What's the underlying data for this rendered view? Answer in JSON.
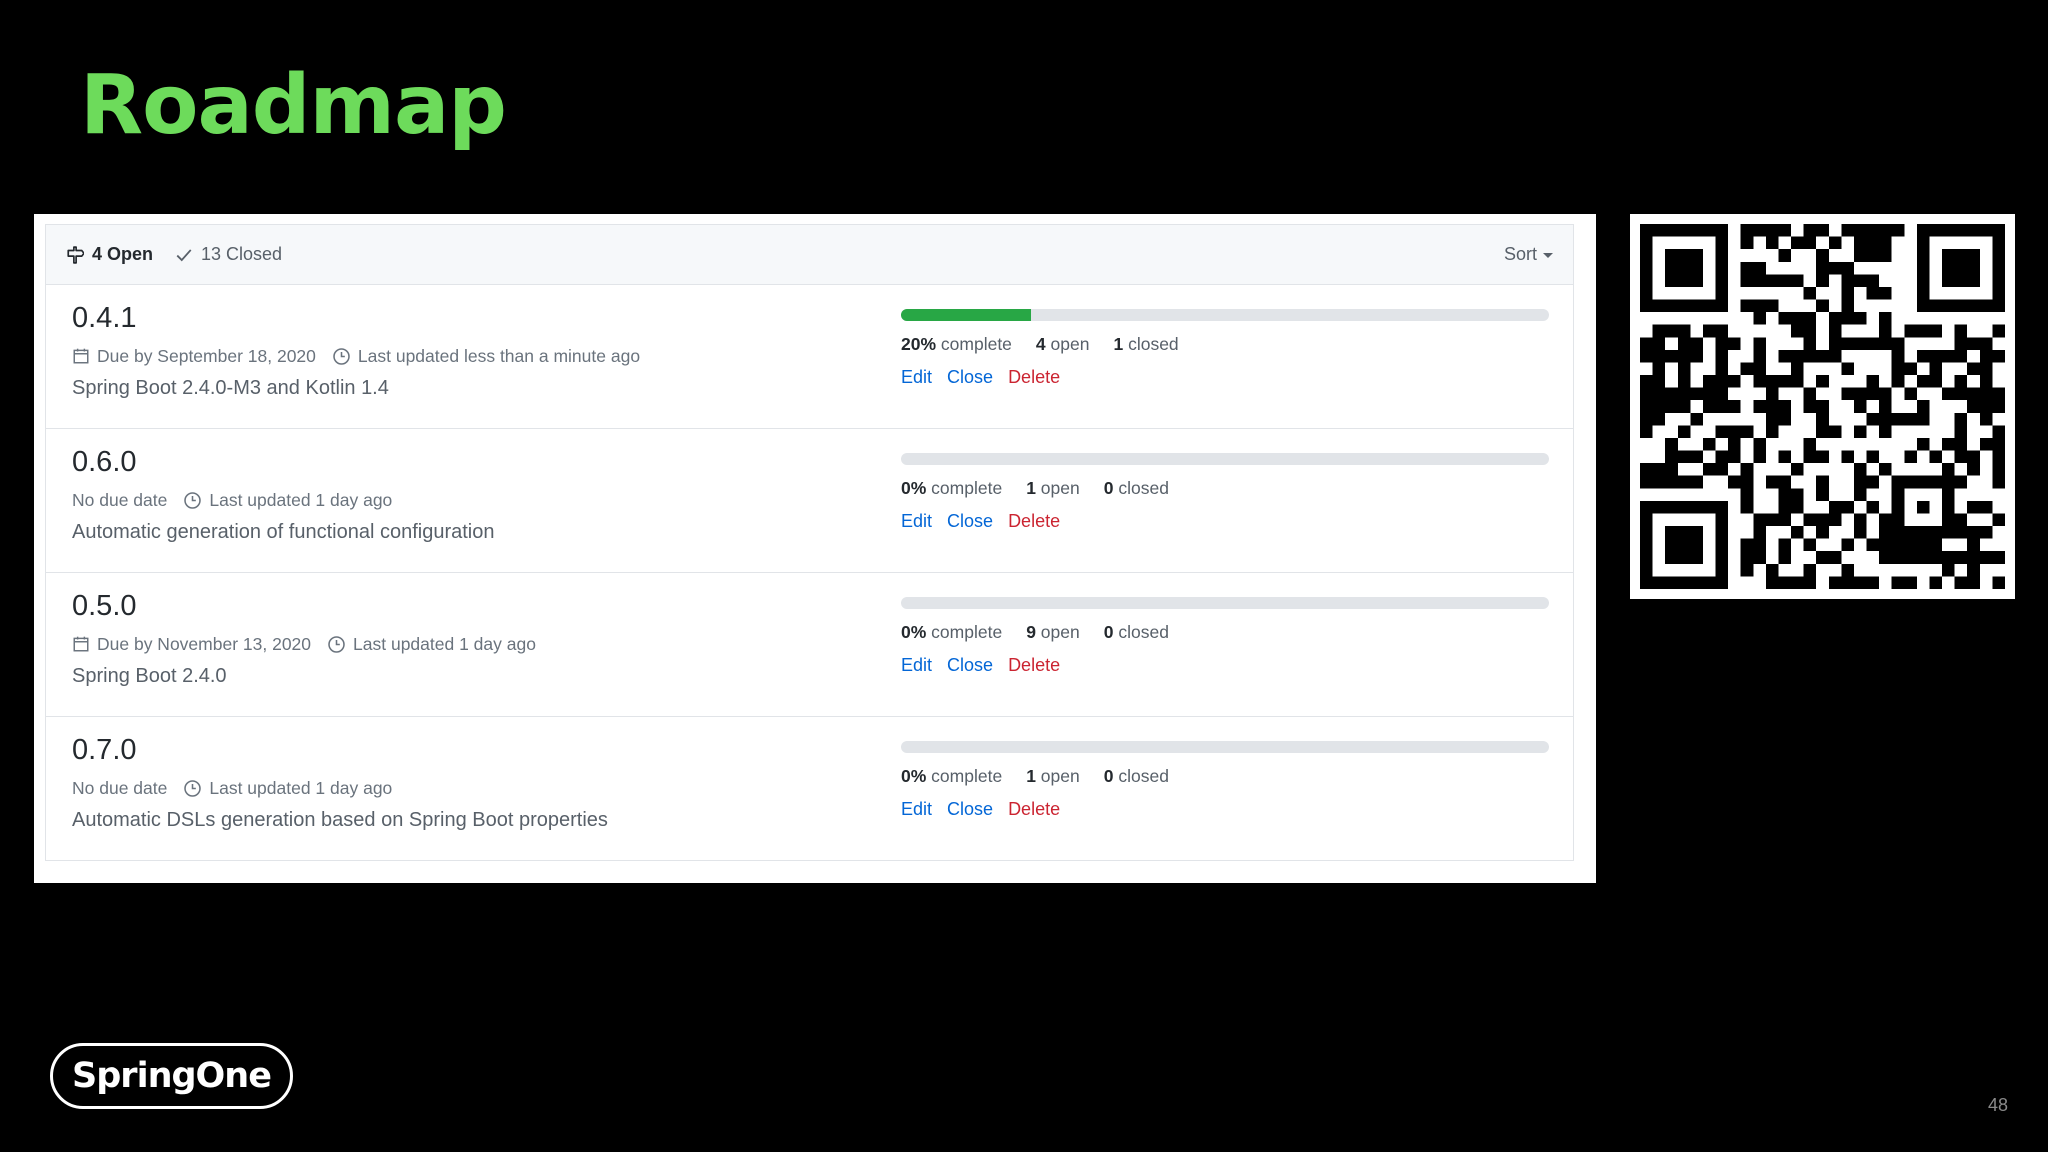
{
  "slide": {
    "title": "Roadmap",
    "page_number": "48",
    "logo_text": "SpringOne",
    "accent_color": "#6ddb5b"
  },
  "milestones": {
    "header": {
      "open_count": "4 Open",
      "closed_count": "13 Closed",
      "sort_label": "Sort",
      "open_icon": "milestone-icon",
      "closed_icon": "check-icon"
    },
    "items": [
      {
        "title": "0.4.1",
        "due": "Due by September 18, 2020",
        "has_due": true,
        "updated": "Last updated less than a minute ago",
        "description": "Spring Boot 2.4.0-M3 and Kotlin 1.4",
        "progress": 0.2,
        "percent": "20%",
        "complete_label": "complete",
        "open": "4",
        "open_label": "open",
        "closed": "1",
        "closed_label": "closed",
        "edit": "Edit",
        "close": "Close",
        "delete": "Delete"
      },
      {
        "title": "0.6.0",
        "due": "No due date",
        "has_due": false,
        "updated": "Last updated 1 day ago",
        "description": "Automatic generation of functional configuration",
        "progress": 0,
        "percent": "0%",
        "complete_label": "complete",
        "open": "1",
        "open_label": "open",
        "closed": "0",
        "closed_label": "closed",
        "edit": "Edit",
        "close": "Close",
        "delete": "Delete"
      },
      {
        "title": "0.5.0",
        "due": "Due by November 13, 2020",
        "has_due": true,
        "updated": "Last updated 1 day ago",
        "description": "Spring Boot 2.4.0",
        "progress": 0,
        "percent": "0%",
        "complete_label": "complete",
        "open": "9",
        "open_label": "open",
        "closed": "0",
        "closed_label": "closed",
        "edit": "Edit",
        "close": "Close",
        "delete": "Delete"
      },
      {
        "title": "0.7.0",
        "due": "No due date",
        "has_due": false,
        "updated": "Last updated 1 day ago",
        "description": "Automatic DSLs generation based on Spring Boot properties",
        "progress": 0,
        "percent": "0%",
        "complete_label": "complete",
        "open": "1",
        "open_label": "open",
        "closed": "0",
        "closed_label": "closed",
        "edit": "Edit",
        "close": "Close",
        "delete": "Delete"
      }
    ]
  },
  "colors": {
    "progress_fill": "#28a745",
    "link": "#0366d6",
    "danger": "#cb2431"
  }
}
